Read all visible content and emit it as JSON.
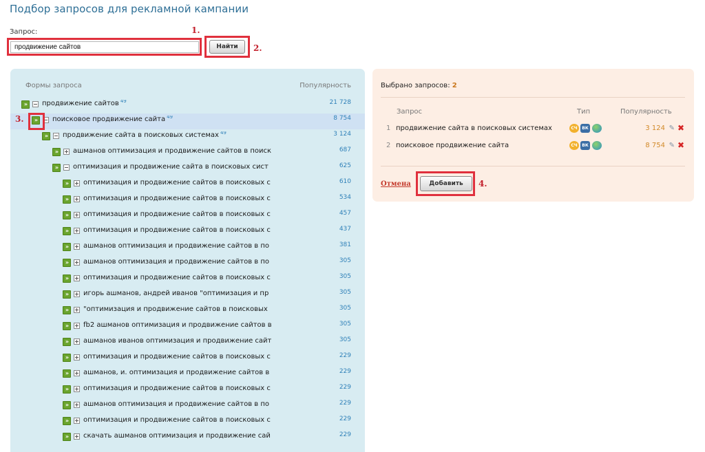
{
  "page": {
    "title": "Подбор запросов для рекламной кампании"
  },
  "search": {
    "label": "Запрос:",
    "value": "продвижение сайтов",
    "button_label": "Найти"
  },
  "annotations": [
    "1.",
    "2.",
    "3.",
    "4."
  ],
  "tree": {
    "header_forms": "Формы запроса",
    "header_popularity": "Популярность",
    "rows": [
      {
        "text": "продвижение сайтов",
        "count": "49",
        "popularity": "21 728",
        "level": 0,
        "toggle": "minus"
      },
      {
        "text": "поисковое продвижение сайта",
        "count": "49",
        "popularity": "8 754",
        "level": 1,
        "toggle": "minus"
      },
      {
        "text": "продвижение сайта в поисковых системах",
        "count": "49",
        "popularity": "3 124",
        "level": 2,
        "toggle": "minus"
      },
      {
        "text": "ашманов оптимизация и продвижение сайтов в поиск",
        "count": "",
        "popularity": "687",
        "level": 3,
        "toggle": "plus"
      },
      {
        "text": "оптимизация и продвижение сайта в поисковых сист",
        "count": "",
        "popularity": "625",
        "level": 3,
        "toggle": "minus"
      },
      {
        "text": "оптимизация и продвижение сайтов в поисковых с",
        "count": "",
        "popularity": "610",
        "level": 4,
        "toggle": "plus"
      },
      {
        "text": "оптимизация и продвижение сайтов в поисковых с",
        "count": "",
        "popularity": "534",
        "level": 4,
        "toggle": "plus"
      },
      {
        "text": "оптимизация и продвижение сайтов в поисковых с",
        "count": "",
        "popularity": "457",
        "level": 4,
        "toggle": "plus"
      },
      {
        "text": "оптимизация и продвижение сайтов в поисковых с",
        "count": "",
        "popularity": "437",
        "level": 4,
        "toggle": "plus"
      },
      {
        "text": "ашманов оптимизация и продвижение сайтов в по",
        "count": "",
        "popularity": "381",
        "level": 4,
        "toggle": "plus"
      },
      {
        "text": "ашманов оптимизация и продвижение сайтов в по",
        "count": "",
        "popularity": "305",
        "level": 4,
        "toggle": "plus"
      },
      {
        "text": "оптимизация и продвижение сайтов в поисковых с",
        "count": "",
        "popularity": "305",
        "level": 4,
        "toggle": "plus"
      },
      {
        "text": "игорь ашманов, андрей иванов \"оптимизация и пр",
        "count": "",
        "popularity": "305",
        "level": 4,
        "toggle": "plus"
      },
      {
        "text": "\"оптимизация и продвижение сайтов в поисковых",
        "count": "",
        "popularity": "305",
        "level": 4,
        "toggle": "plus"
      },
      {
        "text": "fb2 ашманов оптимизация и продвижение сайтов в",
        "count": "",
        "popularity": "305",
        "level": 4,
        "toggle": "plus"
      },
      {
        "text": "ашманов иванов оптимизация и продвижение сайт",
        "count": "",
        "popularity": "305",
        "level": 4,
        "toggle": "plus"
      },
      {
        "text": "оптимизация и продвижение сайтов в поисковых с",
        "count": "",
        "popularity": "229",
        "level": 4,
        "toggle": "plus"
      },
      {
        "text": "ашманов, и. оптимизация и продвижение сайтов в",
        "count": "",
        "popularity": "229",
        "level": 4,
        "toggle": "plus"
      },
      {
        "text": "оптимизация и продвижение сайтов в поисковых с",
        "count": "",
        "popularity": "229",
        "level": 4,
        "toggle": "plus"
      },
      {
        "text": "ашманов оптимизация и продвижение сайтов в по",
        "count": "",
        "popularity": "229",
        "level": 4,
        "toggle": "plus"
      },
      {
        "text": "оптимизация и продвижение сайтов в поисковых с",
        "count": "",
        "popularity": "229",
        "level": 4,
        "toggle": "plus"
      },
      {
        "text": "скачать ашманов оптимизация и продвижение сай",
        "count": "",
        "popularity": "229",
        "level": 4,
        "toggle": "plus"
      }
    ]
  },
  "selected": {
    "label": "Выбрано запросов:",
    "count": "2",
    "columns": {
      "query": "Запрос",
      "type": "Тип",
      "popularity": "Популярность"
    },
    "items": [
      {
        "num": "1",
        "text": "продвижение сайта в поисковых системах",
        "popularity": "3 124"
      },
      {
        "num": "2",
        "text": "поисковое продвижение сайта",
        "popularity": "8 754"
      }
    ],
    "badges": {
      "sch": "СЧ",
      "vk": "ВК",
      "globe": ""
    },
    "cancel_label": "Отмена",
    "add_label": "Добавить"
  },
  "colors": {
    "accent": "#2e6f96",
    "highlight": "#e0303d",
    "left_panel": "#d8ecf2",
    "right_panel": "#fdeee4"
  }
}
